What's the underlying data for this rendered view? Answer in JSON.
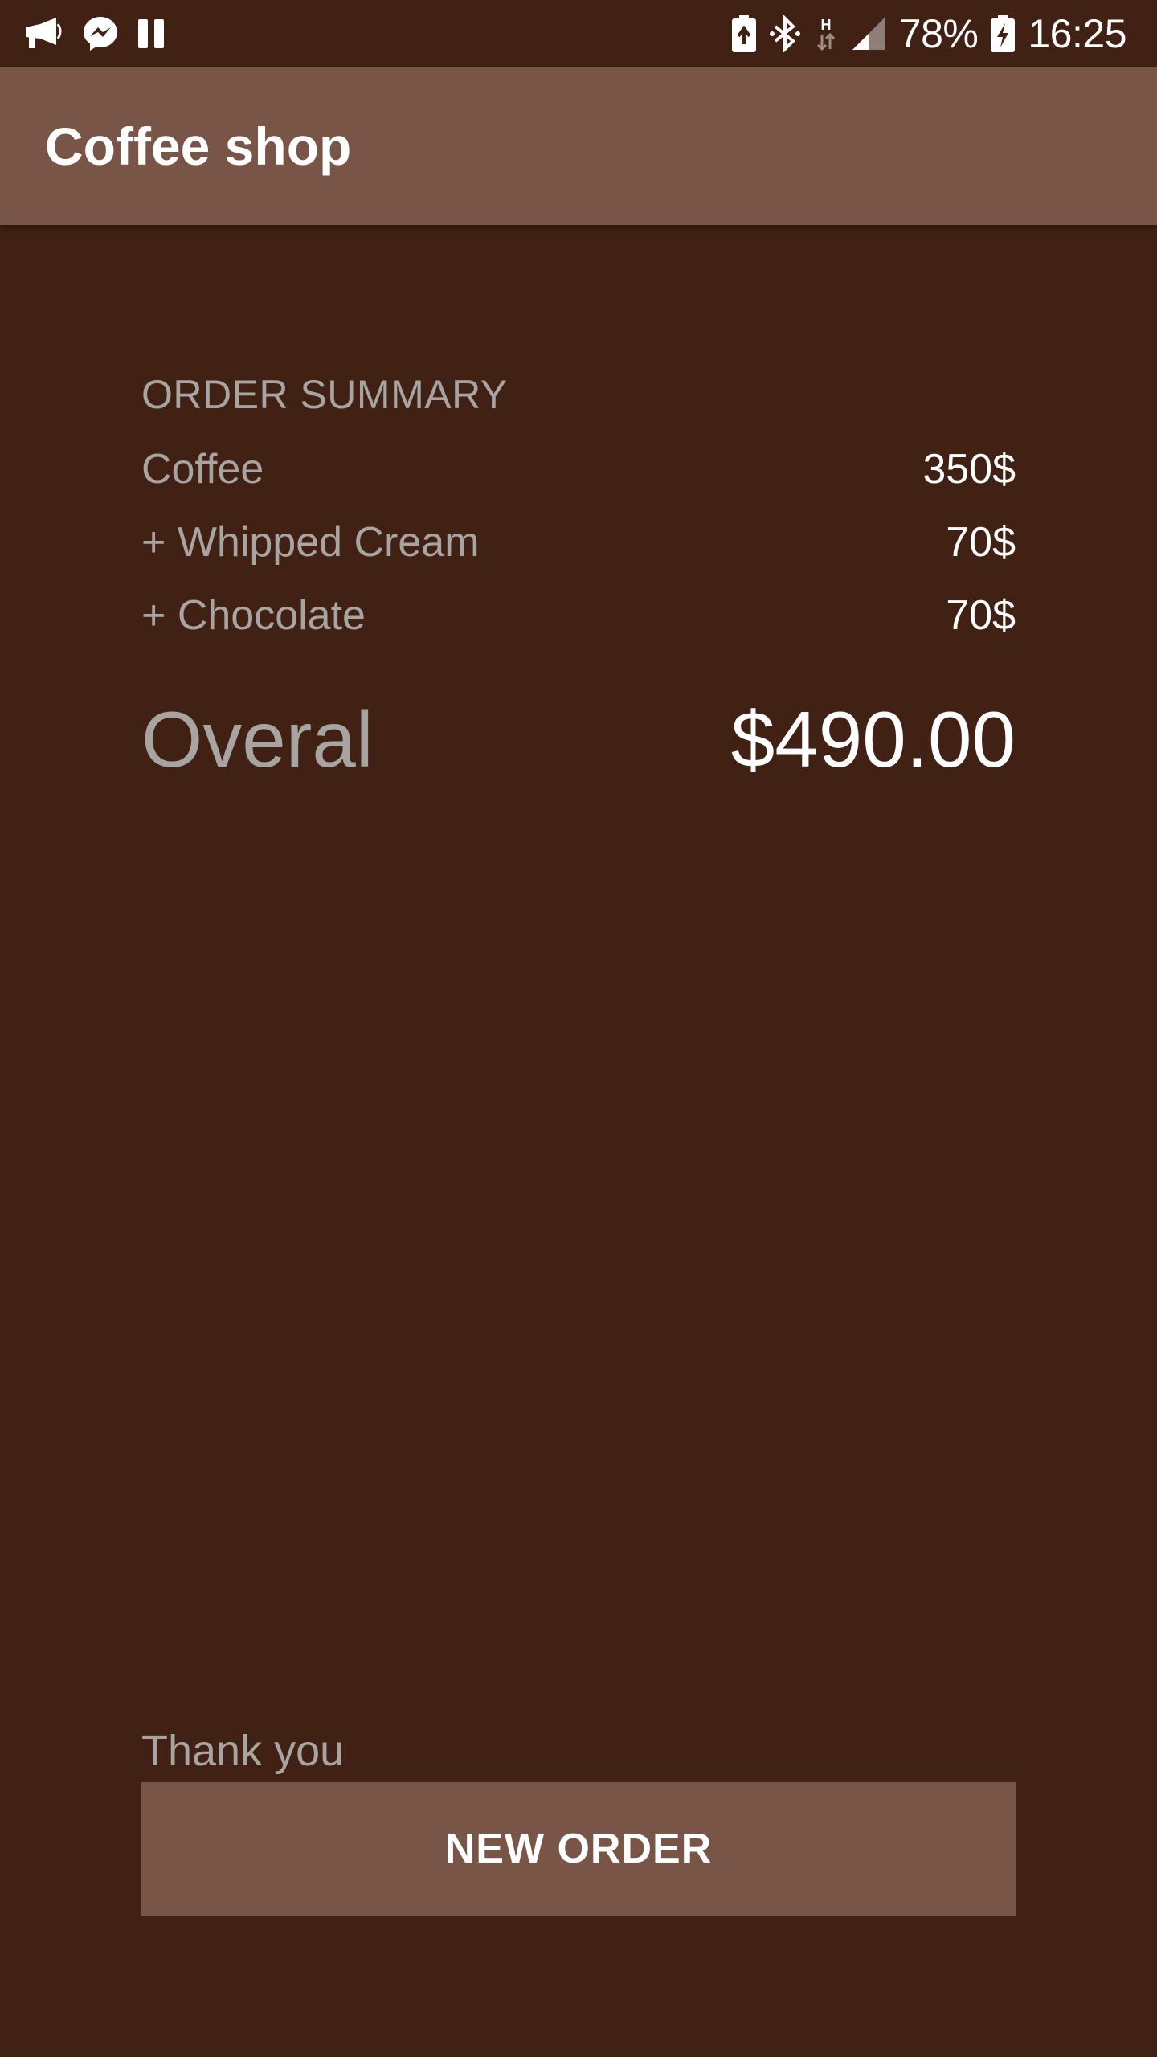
{
  "status_bar": {
    "left_icons": [
      "megaphone-icon",
      "messenger-icon",
      "pause-icon"
    ],
    "right_icons": [
      "battery-saver-icon",
      "bluetooth-icon",
      "network-h-icon",
      "signal-icon"
    ],
    "battery_percent": "78%",
    "time": "16:25"
  },
  "app_bar": {
    "title": "Coffee shop"
  },
  "order": {
    "header": "ORDER SUMMARY",
    "items": [
      {
        "label": "Coffee",
        "price": "350$"
      },
      {
        "label": "+ Whipped Cream",
        "price": "70$"
      },
      {
        "label": "+ Chocolate",
        "price": "70$"
      }
    ],
    "total_label": "Overal",
    "total_value": "$490.00"
  },
  "footer": {
    "thank_you": "Thank you",
    "new_order_label": "NEW ORDER"
  },
  "colors": {
    "background": "#412114",
    "primary": "#795548",
    "secondary_text": "#a8a4a2",
    "primary_text": "#ffffff"
  }
}
